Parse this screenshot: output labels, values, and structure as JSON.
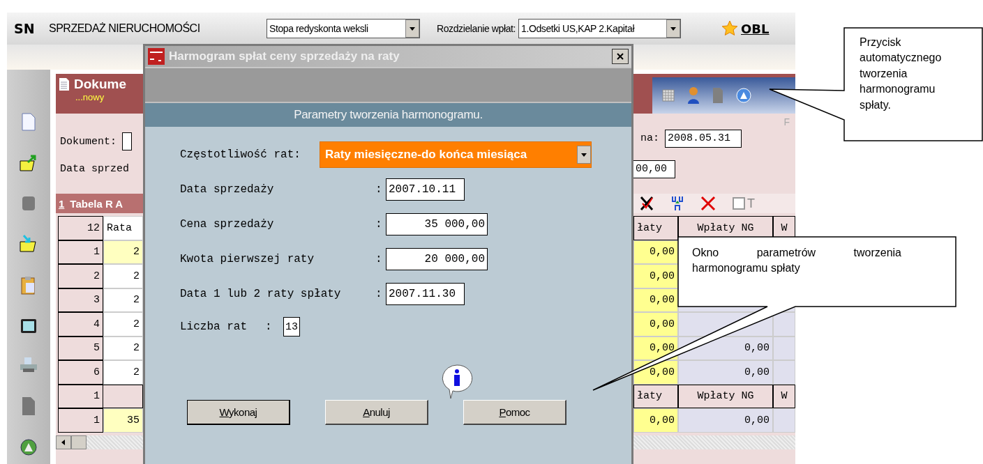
{
  "app": {
    "code": "SN",
    "title": "SPRZEDAŻ NIERUCHOMOŚCI",
    "discount_select": {
      "value": "Stopa redyskonta weksli"
    },
    "split_label": "Rozdzielanie wpłat:",
    "split_select": {
      "value": "1.Odsetki US,KAP 2.Kapitał"
    },
    "calc_button": "OBL"
  },
  "document": {
    "title": "Dokume",
    "status": "...nowy",
    "document_label": "Dokument:",
    "sale_date_label": "Data sprzed",
    "date_label": "na:",
    "date_value": "2008.05.31",
    "amount_value": "00,00",
    "form_letter": "F"
  },
  "table": {
    "tab_number": "1",
    "title": "Tabela R A",
    "count": "12",
    "rata_header": "Rata",
    "right_headers": [
      "łaty",
      "Wpłaty NG",
      "W"
    ],
    "checkbox": {
      "label": "T",
      "checked": false
    },
    "rows": [
      {
        "index": "1",
        "rata": "2",
        "paid": "0,00",
        "selected": true
      },
      {
        "index": "2",
        "rata": "2",
        "paid": "0,00",
        "selected": false
      },
      {
        "index": "3",
        "rata": "2",
        "paid": "0,00",
        "selected": false
      },
      {
        "index": "4",
        "rata": "2",
        "paid": "0,00",
        "selected": false
      },
      {
        "index": "5",
        "rata": "2",
        "paid": "0,00",
        "ng": "0,00",
        "selected": false
      },
      {
        "index": "6",
        "rata": "2",
        "paid": "0,00",
        "ng": "0,00",
        "selected": false
      }
    ],
    "summary": {
      "index": "1",
      "headers": [
        "łaty",
        "Wpłaty NG",
        "W"
      ]
    },
    "total": {
      "index": "1",
      "rata": "35",
      "paid": "0,00",
      "ng": "0,00"
    }
  },
  "dialog": {
    "title": "Harmogram spłat ceny sprzedaży na raty",
    "section": "Parametry tworzenia harmonogramu.",
    "fields": [
      {
        "kind": "dropdown",
        "label": "Częstotliwość rat:",
        "value": "Raty miesięczne-do końca miesiąca"
      },
      {
        "kind": "date",
        "label": "Data sprzedaży",
        "separator": ":",
        "value": "2007.10.11"
      },
      {
        "kind": "amount",
        "label": "Cena sprzedaży",
        "separator": ":",
        "value": "35 000,00"
      },
      {
        "kind": "amount",
        "label": "Kwota pierwszej raty",
        "separator": ":",
        "value": "20 000,00"
      },
      {
        "kind": "date",
        "label": "Data 1 lub 2 raty spłaty",
        "separator": ":",
        "value": "2007.11.30"
      },
      {
        "kind": "count",
        "label": "Liczba rat",
        "separator": ":",
        "value": "13"
      }
    ],
    "buttons": [
      "Wykonaj",
      "Anuluj",
      "Pomoc"
    ]
  },
  "callouts": [
    {
      "text": "Przycisk automatycznego tworzenia harmonogramu spłaty."
    },
    {
      "text": "Okno parametrów tworzenia harmonogramu spłaty"
    }
  ]
}
